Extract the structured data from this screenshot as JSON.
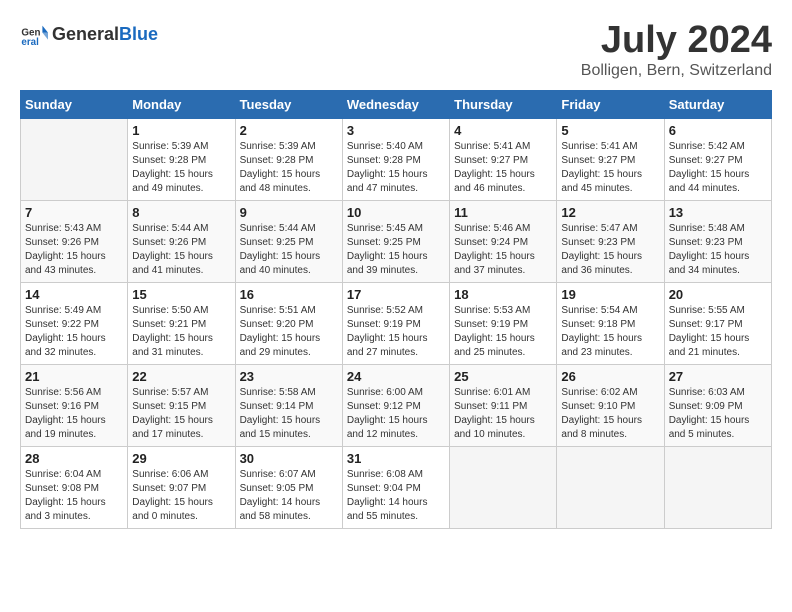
{
  "header": {
    "logo_general": "General",
    "logo_blue": "Blue",
    "title": "July 2024",
    "subtitle": "Bolligen, Bern, Switzerland"
  },
  "calendar": {
    "days_of_week": [
      "Sunday",
      "Monday",
      "Tuesday",
      "Wednesday",
      "Thursday",
      "Friday",
      "Saturday"
    ],
    "weeks": [
      [
        {
          "day": "",
          "info": ""
        },
        {
          "day": "1",
          "info": "Sunrise: 5:39 AM\nSunset: 9:28 PM\nDaylight: 15 hours\nand 49 minutes."
        },
        {
          "day": "2",
          "info": "Sunrise: 5:39 AM\nSunset: 9:28 PM\nDaylight: 15 hours\nand 48 minutes."
        },
        {
          "day": "3",
          "info": "Sunrise: 5:40 AM\nSunset: 9:28 PM\nDaylight: 15 hours\nand 47 minutes."
        },
        {
          "day": "4",
          "info": "Sunrise: 5:41 AM\nSunset: 9:27 PM\nDaylight: 15 hours\nand 46 minutes."
        },
        {
          "day": "5",
          "info": "Sunrise: 5:41 AM\nSunset: 9:27 PM\nDaylight: 15 hours\nand 45 minutes."
        },
        {
          "day": "6",
          "info": "Sunrise: 5:42 AM\nSunset: 9:27 PM\nDaylight: 15 hours\nand 44 minutes."
        }
      ],
      [
        {
          "day": "7",
          "info": "Sunrise: 5:43 AM\nSunset: 9:26 PM\nDaylight: 15 hours\nand 43 minutes."
        },
        {
          "day": "8",
          "info": "Sunrise: 5:44 AM\nSunset: 9:26 PM\nDaylight: 15 hours\nand 41 minutes."
        },
        {
          "day": "9",
          "info": "Sunrise: 5:44 AM\nSunset: 9:25 PM\nDaylight: 15 hours\nand 40 minutes."
        },
        {
          "day": "10",
          "info": "Sunrise: 5:45 AM\nSunset: 9:25 PM\nDaylight: 15 hours\nand 39 minutes."
        },
        {
          "day": "11",
          "info": "Sunrise: 5:46 AM\nSunset: 9:24 PM\nDaylight: 15 hours\nand 37 minutes."
        },
        {
          "day": "12",
          "info": "Sunrise: 5:47 AM\nSunset: 9:23 PM\nDaylight: 15 hours\nand 36 minutes."
        },
        {
          "day": "13",
          "info": "Sunrise: 5:48 AM\nSunset: 9:23 PM\nDaylight: 15 hours\nand 34 minutes."
        }
      ],
      [
        {
          "day": "14",
          "info": "Sunrise: 5:49 AM\nSunset: 9:22 PM\nDaylight: 15 hours\nand 32 minutes."
        },
        {
          "day": "15",
          "info": "Sunrise: 5:50 AM\nSunset: 9:21 PM\nDaylight: 15 hours\nand 31 minutes."
        },
        {
          "day": "16",
          "info": "Sunrise: 5:51 AM\nSunset: 9:20 PM\nDaylight: 15 hours\nand 29 minutes."
        },
        {
          "day": "17",
          "info": "Sunrise: 5:52 AM\nSunset: 9:19 PM\nDaylight: 15 hours\nand 27 minutes."
        },
        {
          "day": "18",
          "info": "Sunrise: 5:53 AM\nSunset: 9:19 PM\nDaylight: 15 hours\nand 25 minutes."
        },
        {
          "day": "19",
          "info": "Sunrise: 5:54 AM\nSunset: 9:18 PM\nDaylight: 15 hours\nand 23 minutes."
        },
        {
          "day": "20",
          "info": "Sunrise: 5:55 AM\nSunset: 9:17 PM\nDaylight: 15 hours\nand 21 minutes."
        }
      ],
      [
        {
          "day": "21",
          "info": "Sunrise: 5:56 AM\nSunset: 9:16 PM\nDaylight: 15 hours\nand 19 minutes."
        },
        {
          "day": "22",
          "info": "Sunrise: 5:57 AM\nSunset: 9:15 PM\nDaylight: 15 hours\nand 17 minutes."
        },
        {
          "day": "23",
          "info": "Sunrise: 5:58 AM\nSunset: 9:14 PM\nDaylight: 15 hours\nand 15 minutes."
        },
        {
          "day": "24",
          "info": "Sunrise: 6:00 AM\nSunset: 9:12 PM\nDaylight: 15 hours\nand 12 minutes."
        },
        {
          "day": "25",
          "info": "Sunrise: 6:01 AM\nSunset: 9:11 PM\nDaylight: 15 hours\nand 10 minutes."
        },
        {
          "day": "26",
          "info": "Sunrise: 6:02 AM\nSunset: 9:10 PM\nDaylight: 15 hours\nand 8 minutes."
        },
        {
          "day": "27",
          "info": "Sunrise: 6:03 AM\nSunset: 9:09 PM\nDaylight: 15 hours\nand 5 minutes."
        }
      ],
      [
        {
          "day": "28",
          "info": "Sunrise: 6:04 AM\nSunset: 9:08 PM\nDaylight: 15 hours\nand 3 minutes."
        },
        {
          "day": "29",
          "info": "Sunrise: 6:06 AM\nSunset: 9:07 PM\nDaylight: 15 hours\nand 0 minutes."
        },
        {
          "day": "30",
          "info": "Sunrise: 6:07 AM\nSunset: 9:05 PM\nDaylight: 14 hours\nand 58 minutes."
        },
        {
          "day": "31",
          "info": "Sunrise: 6:08 AM\nSunset: 9:04 PM\nDaylight: 14 hours\nand 55 minutes."
        },
        {
          "day": "",
          "info": ""
        },
        {
          "day": "",
          "info": ""
        },
        {
          "day": "",
          "info": ""
        }
      ]
    ]
  }
}
